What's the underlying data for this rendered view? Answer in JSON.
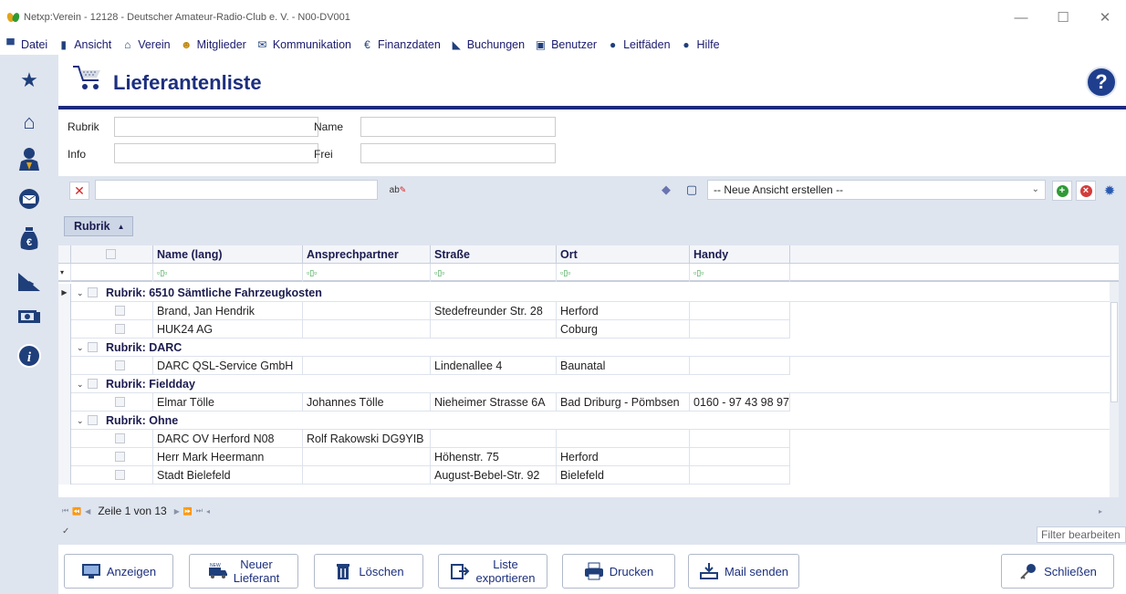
{
  "window": {
    "title": "Netxp:Verein - 12128 - Deutscher Amateur-Radio-Club e. V. - N00-DV001",
    "minimize": "—",
    "maximize": "☐",
    "close": "✕"
  },
  "menu": [
    {
      "label": "Datei",
      "icon": "monitor-icon"
    },
    {
      "label": "Ansicht",
      "icon": "book-icon"
    },
    {
      "label": "Verein",
      "icon": "home-icon"
    },
    {
      "label": "Mitglieder",
      "icon": "members-icon"
    },
    {
      "label": "Kommunikation",
      "icon": "mail-icon"
    },
    {
      "label": "Finanzdaten",
      "icon": "moneybag-icon"
    },
    {
      "label": "Buchungen",
      "icon": "bookings-icon"
    },
    {
      "label": "Benutzer",
      "icon": "user-icon"
    },
    {
      "label": "Leitfäden",
      "icon": "info-icon"
    },
    {
      "label": "Hilfe",
      "icon": "help-icon"
    }
  ],
  "header": {
    "title": "Lieferantenliste",
    "help_label": "?"
  },
  "filters": {
    "rubrik_label": "Rubrik",
    "rubrik_value": "",
    "name_label": "Name",
    "name_value": "",
    "info_label": "Info",
    "info_value": "",
    "frei_label": "Frei",
    "frei_value": ""
  },
  "toolbar": {
    "clear_label": "✕",
    "search_value": "",
    "ab_label": "ab",
    "view_select": "-- Neue Ansicht erstellen --"
  },
  "grouping": {
    "chip": "Rubrik"
  },
  "columns": [
    "Name (lang)",
    "Ansprechpartner",
    "Straße",
    "Ort",
    "Handy"
  ],
  "filter_glyph": "▫▯▫",
  "groups": [
    {
      "label": "Rubrik: 6510 Sämtliche Fahrzeugkosten",
      "rows": [
        [
          "Brand, Jan Hendrik",
          "",
          "Stedefreunder Str. 28",
          "Herford",
          ""
        ],
        [
          "HUK24 AG",
          "",
          "",
          "Coburg",
          ""
        ]
      ]
    },
    {
      "label": "Rubrik: DARC",
      "rows": [
        [
          "DARC QSL-Service GmbH",
          "",
          "Lindenallee 4",
          "Baunatal",
          ""
        ]
      ]
    },
    {
      "label": "Rubrik: Fieldday",
      "rows": [
        [
          "Elmar Tölle",
          "Johannes Tölle",
          "Nieheimer Strasse 6A",
          "Bad Driburg - Pömbsen",
          "0160 - 97 43 98 97"
        ]
      ]
    },
    {
      "label": "Rubrik: Ohne",
      "rows": [
        [
          "DARC OV Herford N08",
          "Rolf Rakowski DG9YIB",
          "",
          "",
          ""
        ],
        [
          "Herr Mark Heermann",
          "",
          "Höhenstr. 75",
          "Herford",
          ""
        ],
        [
          "Stadt Bielefeld",
          "",
          "August-Bebel-Str. 92",
          "Bielefeld",
          ""
        ]
      ]
    }
  ],
  "pager": {
    "text": "Zeile 1 von 13"
  },
  "status": {
    "filter_edit": "Filter bearbeiten"
  },
  "buttons": {
    "show": "Anzeigen",
    "new_line1": "Neuer",
    "new_line2": "Lieferant",
    "delete": "Löschen",
    "export_line1": "Liste",
    "export_line2": "exportieren",
    "print": "Drucken",
    "mail": "Mail senden",
    "close": "Schließen"
  },
  "colors": {
    "brand_blue": "#1c2f7e",
    "sidebar_bg": "#dfe5ef",
    "accent_green": "#2f9a36",
    "accent_red": "#d23b3b"
  }
}
